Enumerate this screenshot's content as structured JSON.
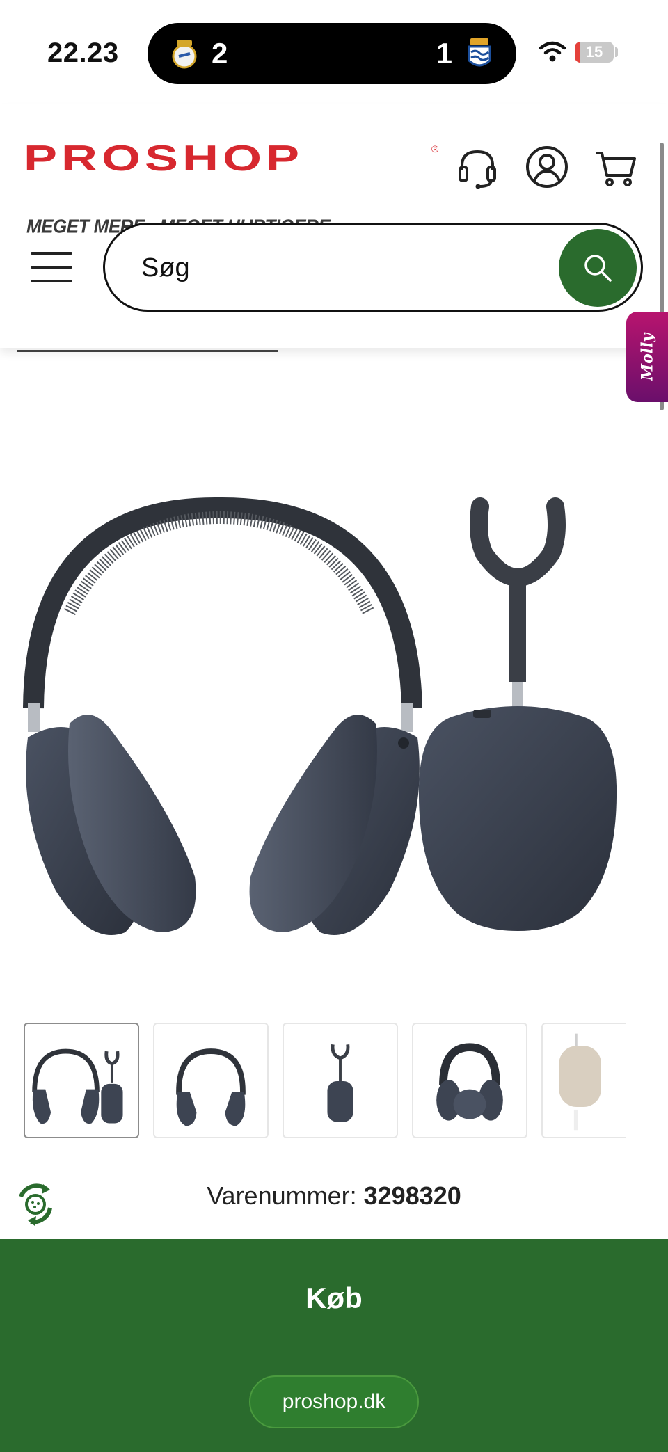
{
  "status_bar": {
    "time": "22.23",
    "live_activity": {
      "home_score": "2",
      "away_score": "1",
      "home_icon": "real-madrid-crest-icon",
      "away_icon": "real-sociedad-crest-icon"
    },
    "wifi_icon": "wifi-icon",
    "battery": {
      "level": 15,
      "label": "15",
      "color": "#e5413b"
    }
  },
  "header": {
    "logo_text": "PROSHOP",
    "logo_tagline": "MEGET MERE › MEGET HURTIGERE »",
    "logo_color": "#d7282f",
    "icons": [
      "headset-support-icon",
      "account-icon",
      "cart-icon"
    ],
    "search": {
      "placeholder": "Søg",
      "button_icon": "search-icon",
      "button_color": "#2a6b2d"
    },
    "menu_icon": "hamburger-menu-icon"
  },
  "side_tab": {
    "label": "Molly"
  },
  "product": {
    "image_alt_icon": "headphones-icon",
    "thumbnails": [
      {
        "icon": "headphones-with-cup-icon",
        "active": true
      },
      {
        "icon": "headphones-front-icon",
        "active": false
      },
      {
        "icon": "headphone-cup-icon",
        "active": false
      },
      {
        "icon": "headphones-worn-icon",
        "active": false
      },
      {
        "icon": "headphones-silver-icon",
        "active": false
      }
    ],
    "sku_label": "Varenummer:",
    "sku_value": "3298320"
  },
  "eco_badge_icon": "recycle-leaf-icon",
  "buy_bar": {
    "buy_label": "Køb",
    "url": "proshop.dk",
    "color": "#2a6b2d"
  }
}
